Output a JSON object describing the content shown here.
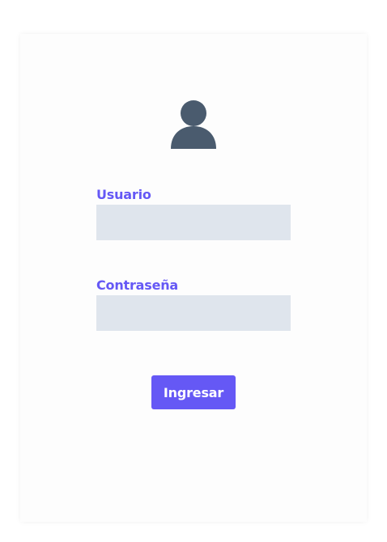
{
  "login": {
    "avatar_icon": "user-icon",
    "username_label": "Usuario",
    "username_value": "",
    "password_label": "Contraseña",
    "password_value": "",
    "submit_label": "Ingresar"
  },
  "colors": {
    "accent": "#6558f5",
    "input_bg": "#dfe5ed",
    "icon": "#4a5b6e"
  }
}
